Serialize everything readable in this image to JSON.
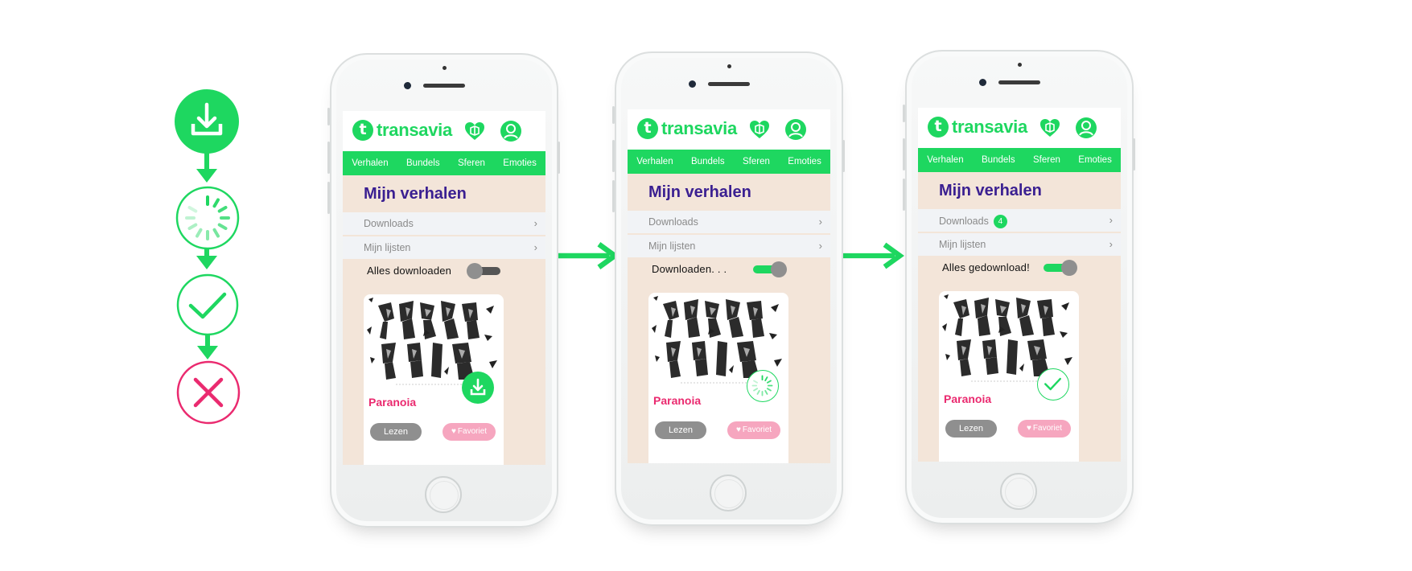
{
  "colors": {
    "brand_green": "#1ed760",
    "title_purple": "#3a1f91",
    "error_red": "#ea2a6f",
    "screen_bg": "#f3e5d9"
  },
  "legend": {
    "states": [
      {
        "name": "download",
        "icon": "download-icon"
      },
      {
        "name": "loading",
        "icon": "spinner-icon"
      },
      {
        "name": "done",
        "icon": "check-icon"
      },
      {
        "name": "error",
        "icon": "close-icon"
      }
    ]
  },
  "app": {
    "logo_text": "transavia",
    "logo_mark": "t",
    "nav": [
      "Verhalen",
      "Bundels",
      "Sferen",
      "Emoties"
    ],
    "page_title": "Mijn verhalen",
    "row_downloads": "Downloads",
    "row_lists": "Mijn lijsten",
    "chevron": "›",
    "card_title": "Paranoia",
    "btn_read": "Lezen",
    "btn_fav": "Favoriet"
  },
  "phones": [
    {
      "state": "idle",
      "download_label": "Alles downloaden",
      "toggle_on": false,
      "badge": ""
    },
    {
      "state": "downloading",
      "download_label": "Downloaden. . .",
      "toggle_on": true,
      "badge": ""
    },
    {
      "state": "downloaded",
      "download_label": "Alles gedownload!",
      "toggle_on": true,
      "badge": "4"
    }
  ]
}
